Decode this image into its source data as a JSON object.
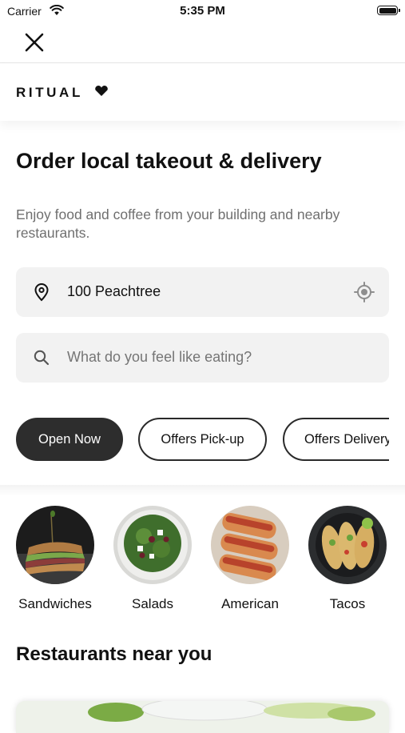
{
  "status_bar": {
    "carrier": "Carrier",
    "time": "5:35 PM"
  },
  "brand": {
    "logo_text": "RITUAL"
  },
  "hero": {
    "title": "Order local takeout & delivery",
    "subtitle": "Enjoy food and coffee from your building and nearby restaurants."
  },
  "location": {
    "value": "100 Peachtree"
  },
  "search": {
    "placeholder": "What do you feel like eating?"
  },
  "filters": [
    {
      "label": "Open Now",
      "active": true
    },
    {
      "label": "Offers Pick-up",
      "active": false
    },
    {
      "label": "Offers Delivery",
      "active": false
    }
  ],
  "categories": [
    {
      "label": "Sandwiches"
    },
    {
      "label": "Salads"
    },
    {
      "label": "American"
    },
    {
      "label": "Tacos"
    }
  ],
  "restaurants": {
    "title": "Restaurants near you"
  },
  "colors": {
    "pill_active": "#2d2d2d",
    "field_bg": "#f2f2f2",
    "subtitle": "#6f6f6f"
  }
}
